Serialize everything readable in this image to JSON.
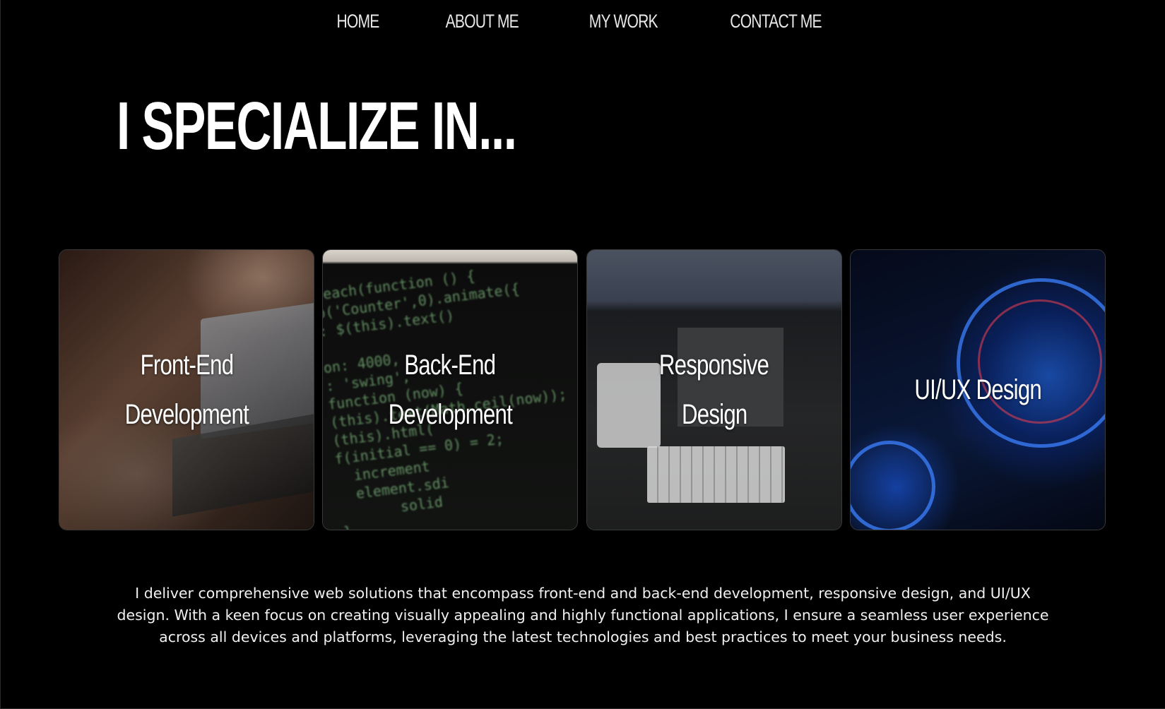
{
  "nav": {
    "items": [
      {
        "label": "HOME"
      },
      {
        "label": "ABOUT ME"
      },
      {
        "label": "MY WORK"
      },
      {
        "label": "CONTACT ME"
      }
    ]
  },
  "section": {
    "heading": "I SPECIALIZE IN...",
    "cards": [
      {
        "line1": "Front-End",
        "line2": "Development"
      },
      {
        "line1": "Back-End",
        "line2": "Development"
      },
      {
        "line1": "Responsive",
        "line2": "Design"
      },
      {
        "line1": "UI/UX Design",
        "line2": ""
      }
    ],
    "description": "I deliver comprehensive web solutions that encompass front-end and back-end development, responsive design, and UI/UX design. With a keen focus on creating visually appealing and highly functional applications, I ensure a seamless user experience across all devices and platforms, leveraging the latest technologies and best practices to meet your business needs."
  },
  "colors": {
    "background": "#000000",
    "text": "#ffffff"
  }
}
